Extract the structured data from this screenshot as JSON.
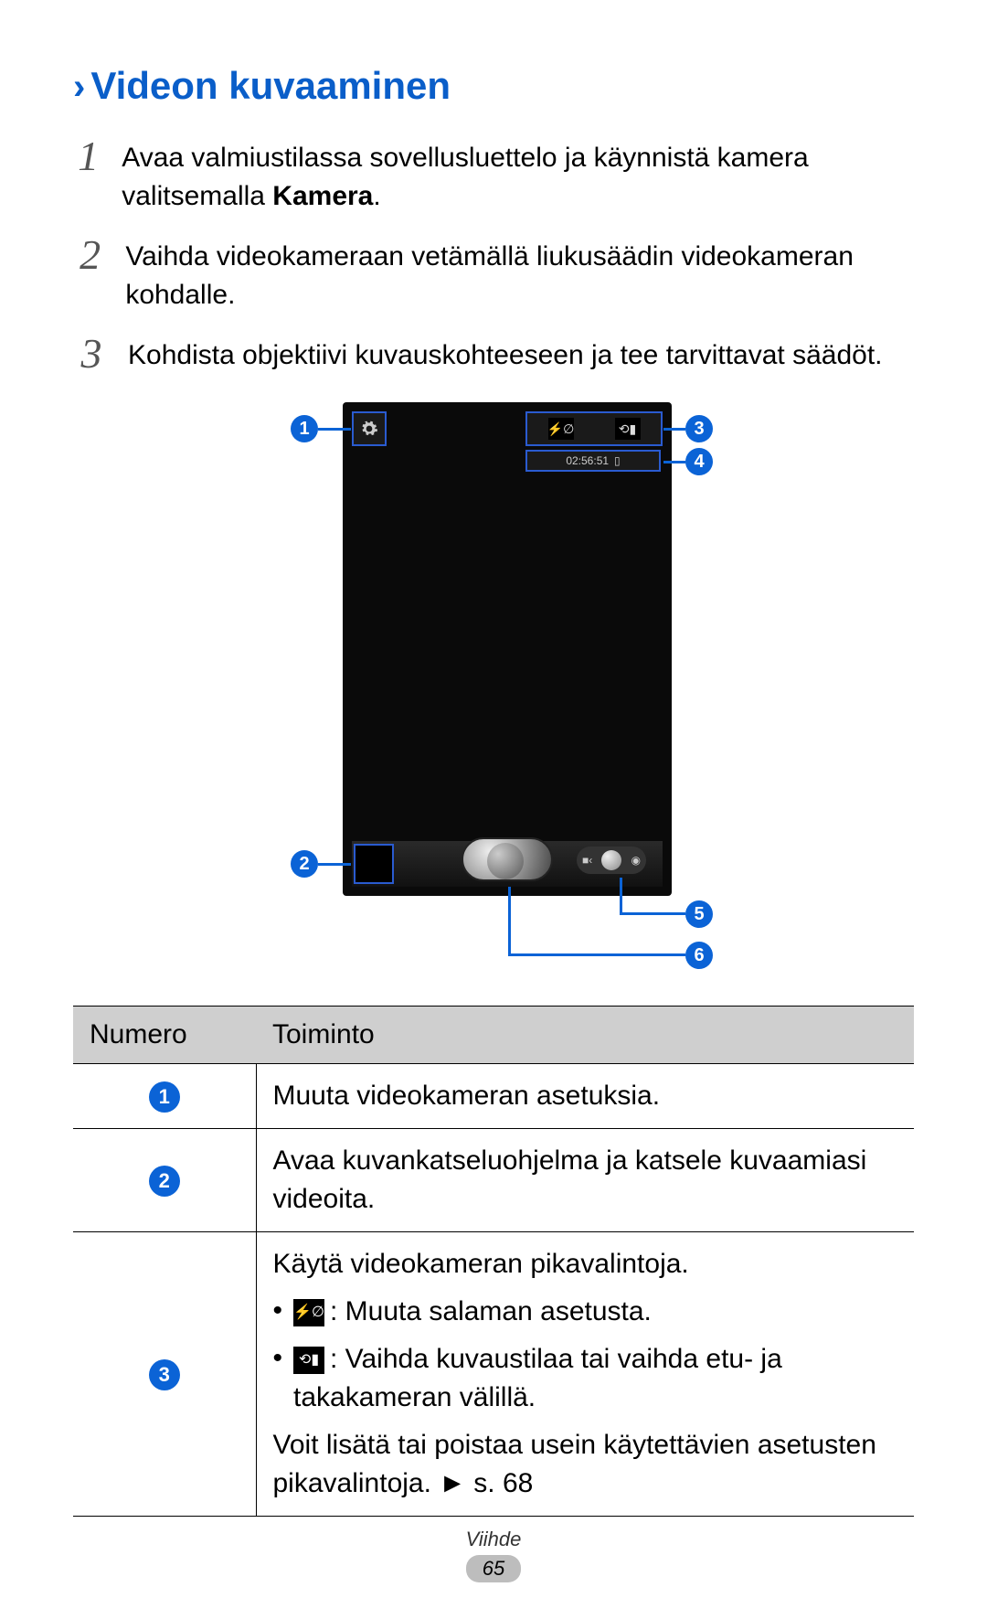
{
  "heading": "Videon kuvaaminen",
  "steps": [
    {
      "num": "1",
      "text_before": "Avaa valmiustilassa sovellusluettelo ja käynnistä kamera valitsemalla ",
      "bold": "Kamera",
      "text_after": "."
    },
    {
      "num": "2",
      "text_before": "Vaihda videokameraan vetämällä liukusäädin videokameran kohdalle.",
      "bold": "",
      "text_after": ""
    },
    {
      "num": "3",
      "text_before": "Kohdista objektiivi kuvauskohteeseen ja tee tarvittavat säädöt.",
      "bold": "",
      "text_after": ""
    }
  ],
  "figure": {
    "timer": "02:56:51",
    "callouts": {
      "c1": "1",
      "c2": "2",
      "c3": "3",
      "c4": "4",
      "c5": "5",
      "c6": "6"
    }
  },
  "table": {
    "headers": {
      "num": "Numero",
      "func": "Toiminto"
    },
    "rows": [
      {
        "n": "1",
        "body": {
          "intro": "Muuta videokameran asetuksia."
        }
      },
      {
        "n": "2",
        "body": {
          "intro": "Avaa kuvankatseluohjelma ja katsele kuvaamiasi videoita."
        }
      },
      {
        "n": "3",
        "body": {
          "intro": "Käytä videokameran pikavalintoja.",
          "bullets": [
            {
              "icon": "flash",
              "text": ": Muuta salaman asetusta."
            },
            {
              "icon": "switch",
              "text": ": Vaihda kuvaustilaa tai vaihda etu- ja takakameran välillä."
            }
          ],
          "outro": "Voit lisätä tai poistaa usein käytettävien asetusten pikavalintoja. ► s. 68"
        }
      }
    ]
  },
  "footer": {
    "category": "Viihde",
    "page": "65"
  }
}
